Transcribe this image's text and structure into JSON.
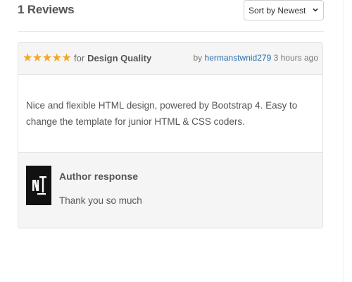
{
  "reviews_header": {
    "count_label": "1 Reviews",
    "sort_selected": "Sort by Newest"
  },
  "review": {
    "rating": 5,
    "stars": "★★★★★",
    "for_word": "for",
    "category": "Design Quality",
    "by_word": "by",
    "author": "hermanstwnid279",
    "time_ago": "3 hours ago",
    "text": "Nice and flexible HTML design, powered by Bootstrap 4. Easy to change the template for junior HTML & CSS coders."
  },
  "author_response": {
    "title": "Author response",
    "text": "Thank you so much",
    "avatar_icon": "nt-logo-icon"
  },
  "colors": {
    "star": "#f5a623",
    "link": "#2a6db0",
    "panel_bg": "#f5f5f5"
  }
}
